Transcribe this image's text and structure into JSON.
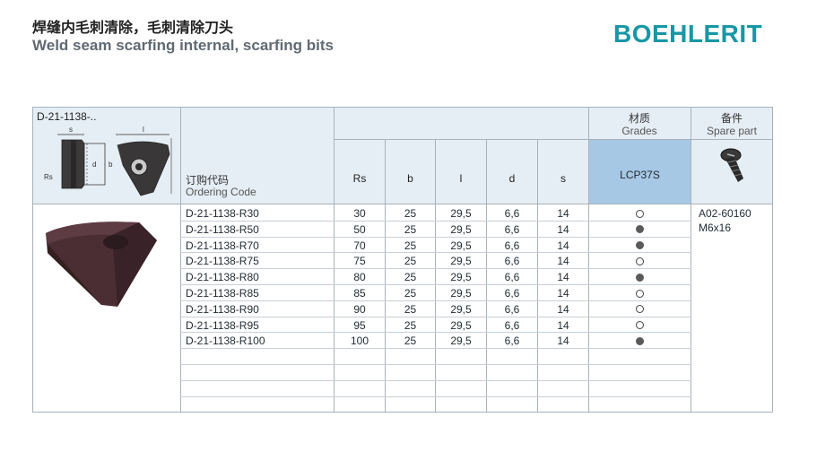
{
  "header": {
    "title_zh": "焊缝内毛刺清除，毛刺清除刀头",
    "title_en": "Weld seam scarfing internal, scarfing bits",
    "brand": "BOEHLERIT"
  },
  "table": {
    "id_label": "D-21-1138-..",
    "drawing_labels": {
      "s": "s",
      "l": "l",
      "d": "d",
      "b": "b",
      "rs": "Rs"
    },
    "ordering_code_zh": "订购代码",
    "ordering_code_en": "Ordering Code",
    "grades_zh": "材质",
    "grades_en": "Grades",
    "spare_zh": "备件",
    "spare_en": "Spare part",
    "columns": [
      "Rs",
      "b",
      "l",
      "d",
      "s"
    ],
    "grade_name": "LCP37S",
    "spare_part": {
      "code": "A02-60160",
      "screw": "M6x16"
    },
    "rows": [
      {
        "code": "D-21-1138-R30",
        "rs": "30",
        "b": "25",
        "l": "29,5",
        "d": "6,6",
        "s": "14",
        "grade": "open"
      },
      {
        "code": "D-21-1138-R50",
        "rs": "50",
        "b": "25",
        "l": "29,5",
        "d": "6,6",
        "s": "14",
        "grade": "filled"
      },
      {
        "code": "D-21-1138-R70",
        "rs": "70",
        "b": "25",
        "l": "29,5",
        "d": "6,6",
        "s": "14",
        "grade": "filled"
      },
      {
        "code": "D-21-1138-R75",
        "rs": "75",
        "b": "25",
        "l": "29,5",
        "d": "6,6",
        "s": "14",
        "grade": "open"
      },
      {
        "code": "D-21-1138-R80",
        "rs": "80",
        "b": "25",
        "l": "29,5",
        "d": "6,6",
        "s": "14",
        "grade": "filled"
      },
      {
        "code": "D-21-1138-R85",
        "rs": "85",
        "b": "25",
        "l": "29,5",
        "d": "6,6",
        "s": "14",
        "grade": "open"
      },
      {
        "code": "D-21-1138-R90",
        "rs": "90",
        "b": "25",
        "l": "29,5",
        "d": "6,6",
        "s": "14",
        "grade": "open"
      },
      {
        "code": "D-21-1138-R95",
        "rs": "95",
        "b": "25",
        "l": "29,5",
        "d": "6,6",
        "s": "14",
        "grade": "open"
      },
      {
        "code": "D-21-1138-R100",
        "rs": "100",
        "b": "25",
        "l": "29,5",
        "d": "6,6",
        "s": "14",
        "grade": "filled"
      }
    ],
    "empty_rows": 4
  }
}
